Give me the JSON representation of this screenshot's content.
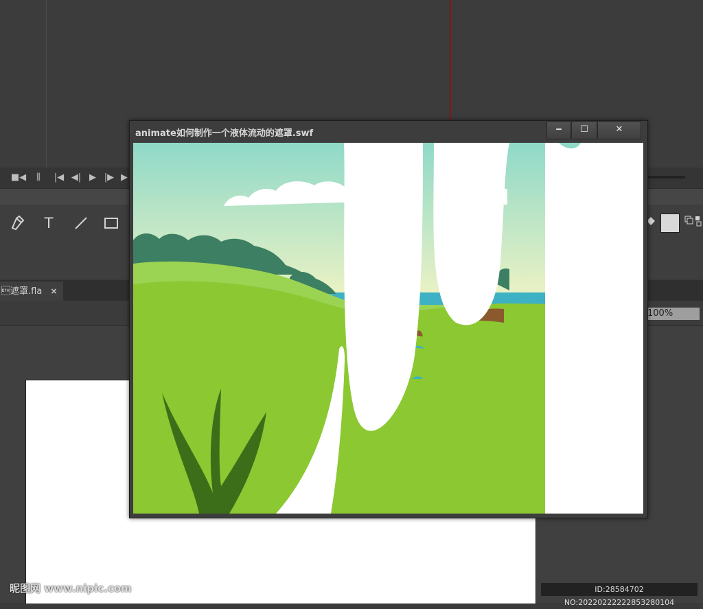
{
  "ide": {
    "doc_tab_label": "\u0003遮罩.fla",
    "doc_tab_close": "×",
    "zoom_value": "100%",
    "timeline_buttons": [
      "■◀",
      "⫼",
      "|◀",
      "◀|",
      "▶",
      "|▶",
      "▶"
    ],
    "tools": [
      "pen-tool",
      "T",
      "line-tool",
      "rectangle-tool"
    ]
  },
  "player": {
    "title": "animate如何制作一个液体流动的遮罩.swf",
    "minimize_label": "‒",
    "maximize_label": "☐",
    "close_label": "✕"
  },
  "scene": {
    "sky_top": "#8fd9c8",
    "sky_bottom": "#eef3c4",
    "sea": "#3eb1c4",
    "hill_dark": "#3c7f62",
    "grass_light": "#9bd353",
    "grass": "#8bc832",
    "plant": "#3c6e1a",
    "mask_white": "#ffffff"
  },
  "watermark": {
    "site": "昵图网 www.nipic.com",
    "id_text": "ID:28584702 NO:20220222222853280104"
  }
}
